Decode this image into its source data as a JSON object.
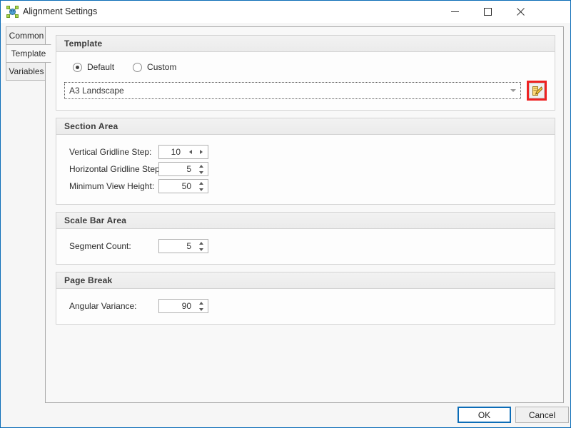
{
  "window": {
    "title": "Alignment Settings",
    "icon": "alignment-network-icon",
    "accent_color": "#0b6cb7",
    "controls": {
      "minimize": "—",
      "maximize": "☐",
      "close": "✕"
    }
  },
  "tabs": [
    {
      "label": "Common",
      "active": false
    },
    {
      "label": "Template",
      "active": true
    },
    {
      "label": "Variables",
      "active": false
    }
  ],
  "groups": {
    "template": {
      "header": "Template",
      "radios": [
        {
          "label": "Default",
          "checked": true
        },
        {
          "label": "Custom",
          "checked": false
        }
      ],
      "combo": {
        "value": "A3 Landscape",
        "arrow_icon": "chevron-down-icon"
      },
      "browse_button": {
        "icon": "edit-template-icon",
        "highlight_color": "#ee2222"
      }
    },
    "section_area": {
      "header": "Section Area",
      "fields": [
        {
          "label": "Vertical Gridline Step:",
          "value": "10",
          "spinner": "horizontal"
        },
        {
          "label": "Horizontal Gridline Step:",
          "value": "5",
          "spinner": "vertical"
        },
        {
          "label": "Minimum View Height:",
          "value": "50",
          "spinner": "vertical"
        }
      ]
    },
    "scale_bar_area": {
      "header": "Scale Bar Area",
      "fields": [
        {
          "label": "Segment Count:",
          "value": "5",
          "spinner": "vertical"
        }
      ]
    },
    "page_break": {
      "header": "Page Break",
      "fields": [
        {
          "label": "Angular Variance:",
          "value": "90",
          "spinner": "vertical"
        }
      ]
    }
  },
  "footer": {
    "ok_label": "OK",
    "cancel_label": "Cancel"
  }
}
